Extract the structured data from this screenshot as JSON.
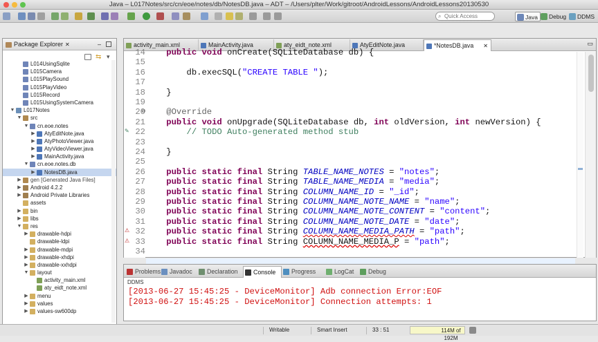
{
  "window": {
    "title": "Java – L017Notes/src/cn/eoe/notes/db/NotesDB.java – ADT – /Users/plter/Work/gitroot/AndroidLessons/AndroidLessons20130530"
  },
  "toolbar": {
    "quick_access_placeholder": "Quick Access",
    "perspectives": [
      "Java",
      "Debug",
      "DDMS"
    ]
  },
  "package_explorer": {
    "title": "Package Explorer",
    "items": [
      {
        "label": "L014UsingSqlite",
        "depth": 1,
        "twisty": "",
        "icon": "package"
      },
      {
        "label": "L015Camera",
        "depth": 1,
        "twisty": "",
        "icon": "package"
      },
      {
        "label": "L015PlaySound",
        "depth": 1,
        "twisty": "",
        "icon": "package"
      },
      {
        "label": "L015PlayVideo",
        "depth": 1,
        "twisty": "",
        "icon": "package"
      },
      {
        "label": "L015Record",
        "depth": 1,
        "twisty": "",
        "icon": "package"
      },
      {
        "label": "L015UsingSystemCamera",
        "depth": 1,
        "twisty": "",
        "icon": "package"
      },
      {
        "label": "L017Notes",
        "depth": 0,
        "twisty": "▼",
        "icon": "project"
      },
      {
        "label": "src",
        "depth": 1,
        "twisty": "▼",
        "icon": "src"
      },
      {
        "label": "cn.eoe.notes",
        "depth": 2,
        "twisty": "▼",
        "icon": "package"
      },
      {
        "label": "AtyEditNote.java",
        "depth": 3,
        "twisty": "▶",
        "icon": "java"
      },
      {
        "label": "AtyPhotoViewer.java",
        "depth": 3,
        "twisty": "▶",
        "icon": "java"
      },
      {
        "label": "AtyVideoViewer.java",
        "depth": 3,
        "twisty": "▶",
        "icon": "java"
      },
      {
        "label": "MainActivity.java",
        "depth": 3,
        "twisty": "▶",
        "icon": "java"
      },
      {
        "label": "cn.eoe.notes.db",
        "depth": 2,
        "twisty": "▼",
        "icon": "package"
      },
      {
        "label": "NotesDB.java",
        "depth": 3,
        "twisty": "▶",
        "icon": "java",
        "selected": true
      },
      {
        "label": "gen [Generated Java Files]",
        "depth": 1,
        "twisty": "▶",
        "icon": "gen"
      },
      {
        "label": "Android 4.2.2",
        "depth": 1,
        "twisty": "▶",
        "icon": "lib"
      },
      {
        "label": "Android Private Libraries",
        "depth": 1,
        "twisty": "▶",
        "icon": "lib"
      },
      {
        "label": "assets",
        "depth": 1,
        "twisty": "",
        "icon": "folder"
      },
      {
        "label": "bin",
        "depth": 1,
        "twisty": "▶",
        "icon": "folder"
      },
      {
        "label": "libs",
        "depth": 1,
        "twisty": "▶",
        "icon": "folder"
      },
      {
        "label": "res",
        "depth": 1,
        "twisty": "▼",
        "icon": "folder"
      },
      {
        "label": "drawable-hdpi",
        "depth": 2,
        "twisty": "▶",
        "icon": "folder"
      },
      {
        "label": "drawable-ldpi",
        "depth": 2,
        "twisty": "",
        "icon": "folder"
      },
      {
        "label": "drawable-mdpi",
        "depth": 2,
        "twisty": "▶",
        "icon": "folder"
      },
      {
        "label": "drawable-xhdpi",
        "depth": 2,
        "twisty": "▶",
        "icon": "folder"
      },
      {
        "label": "drawable-xxhdpi",
        "depth": 2,
        "twisty": "▶",
        "icon": "folder"
      },
      {
        "label": "layout",
        "depth": 2,
        "twisty": "▼",
        "icon": "folder"
      },
      {
        "label": "activity_main.xml",
        "depth": 3,
        "twisty": "",
        "icon": "xml"
      },
      {
        "label": "aty_eidt_note.xml",
        "depth": 3,
        "twisty": "",
        "icon": "xml"
      },
      {
        "label": "menu",
        "depth": 2,
        "twisty": "▶",
        "icon": "folder"
      },
      {
        "label": "values",
        "depth": 2,
        "twisty": "▶",
        "icon": "folder"
      },
      {
        "label": "values-sw600dp",
        "depth": 2,
        "twisty": "▶",
        "icon": "folder"
      }
    ]
  },
  "editor": {
    "tabs": [
      {
        "label": "activity_main.xml",
        "icon": "xml"
      },
      {
        "label": "MainActivity.java",
        "icon": "java"
      },
      {
        "label": "aty_eidt_note.xml",
        "icon": "xml"
      },
      {
        "label": "AtyEditNote.java",
        "icon": "java"
      },
      {
        "label": "*NotesDB.java",
        "icon": "java",
        "active": true
      }
    ],
    "line_numbers": [
      "14",
      "15",
      "16",
      "17",
      "18",
      "19",
      "20",
      "21",
      "22",
      "23",
      "24",
      "25",
      "26",
      "27",
      "28",
      "29",
      "30",
      "31",
      "32",
      "33",
      "34"
    ],
    "lines": [
      [
        [
          "kw",
          "    public "
        ],
        [
          "kw",
          "void "
        ],
        [
          "",
          "onCreate(SQLiteDatabase db) {"
        ]
      ],
      [
        [
          "",
          ""
        ]
      ],
      [
        [
          "",
          "        db.execSQL("
        ],
        [
          "str",
          "\"CREATE TABLE \""
        ],
        [
          "",
          ");"
        ]
      ],
      [
        [
          "",
          ""
        ]
      ],
      [
        [
          "",
          "    }"
        ]
      ],
      [
        [
          "",
          ""
        ]
      ],
      [
        [
          "ann",
          "    @Override"
        ]
      ],
      [
        [
          "kw",
          "    public "
        ],
        [
          "kw",
          "void "
        ],
        [
          "",
          "onUpgrade(SQLiteDatabase db, "
        ],
        [
          "kw",
          "int "
        ],
        [
          "",
          "oldVersion, "
        ],
        [
          "kw",
          "int "
        ],
        [
          "",
          "newVersion) {"
        ]
      ],
      [
        [
          "cm",
          "        // TODO Auto-generated method stub"
        ]
      ],
      [
        [
          "",
          ""
        ]
      ],
      [
        [
          "",
          "    }"
        ]
      ],
      [
        [
          "",
          ""
        ]
      ],
      [
        [
          "kw",
          "    public static final "
        ],
        [
          "",
          "String "
        ],
        [
          "it",
          "TABLE_NAME_NOTES"
        ],
        [
          "",
          " = "
        ],
        [
          "str",
          "\"notes\""
        ],
        [
          "",
          ";"
        ]
      ],
      [
        [
          "kw",
          "    public static final "
        ],
        [
          "",
          "String "
        ],
        [
          "it",
          "TABLE_NAME_MEDIA"
        ],
        [
          "",
          " = "
        ],
        [
          "str",
          "\"media\""
        ],
        [
          "",
          ";"
        ]
      ],
      [
        [
          "kw",
          "    public static final "
        ],
        [
          "",
          "String "
        ],
        [
          "it",
          "COLUMN_NAME_ID"
        ],
        [
          "",
          " = "
        ],
        [
          "str",
          "\"_id\""
        ],
        [
          "",
          ";"
        ]
      ],
      [
        [
          "kw",
          "    public static final "
        ],
        [
          "",
          "String "
        ],
        [
          "it",
          "COLUMN_NAME_NOTE_NAME"
        ],
        [
          "",
          " = "
        ],
        [
          "str",
          "\"name\""
        ],
        [
          "",
          ";"
        ]
      ],
      [
        [
          "kw",
          "    public static final "
        ],
        [
          "",
          "String "
        ],
        [
          "it",
          "COLUMN_NAME_NOTE_CONTENT"
        ],
        [
          "",
          " = "
        ],
        [
          "str",
          "\"content\""
        ],
        [
          "",
          ";"
        ]
      ],
      [
        [
          "kw",
          "    public static final "
        ],
        [
          "",
          "String "
        ],
        [
          "it",
          "COLUMN_NAME_NOTE_DATE"
        ],
        [
          "",
          " = "
        ],
        [
          "str",
          "\"date\""
        ],
        [
          "",
          ";"
        ]
      ],
      [
        [
          "kw",
          "    public static final "
        ],
        [
          "",
          "String "
        ],
        [
          "it",
          "COLUMN_NAME_MEDIA_PATH"
        ],
        [
          "",
          " = "
        ],
        [
          "str",
          "\"path\""
        ],
        [
          "",
          ";"
        ]
      ],
      [
        [
          "kw",
          "    public static final "
        ],
        [
          "",
          "String "
        ],
        [
          "",
          "COLUMN_NAME_MEDIA_P"
        ],
        [
          "",
          " = "
        ],
        [
          "str",
          "\"path\""
        ],
        [
          "",
          ";"
        ]
      ],
      [
        [
          "",
          ""
        ]
      ]
    ]
  },
  "bottom_panel": {
    "tabs": [
      "Problems",
      "Javadoc",
      "Declaration",
      "Console",
      "Progress",
      "LogCat",
      "Debug"
    ],
    "active_tab": "Console",
    "console_label": "DDMS",
    "console_lines": [
      "[2013-06-27 15:45:25 - DeviceMonitor] Adb connection Error:EOF",
      "[2013-06-27 15:45:25 - DeviceMonitor] Connection attempts: 1"
    ]
  },
  "status": {
    "mode": "Writable",
    "insert": "Smart Insert",
    "position": "33 : 51",
    "memory": "114M of 192M"
  },
  "colors": {
    "keyword": "#7f0055",
    "string": "#2a00ff",
    "field": "#0000c0",
    "comment": "#3f7f5f",
    "error": "#d01010"
  }
}
